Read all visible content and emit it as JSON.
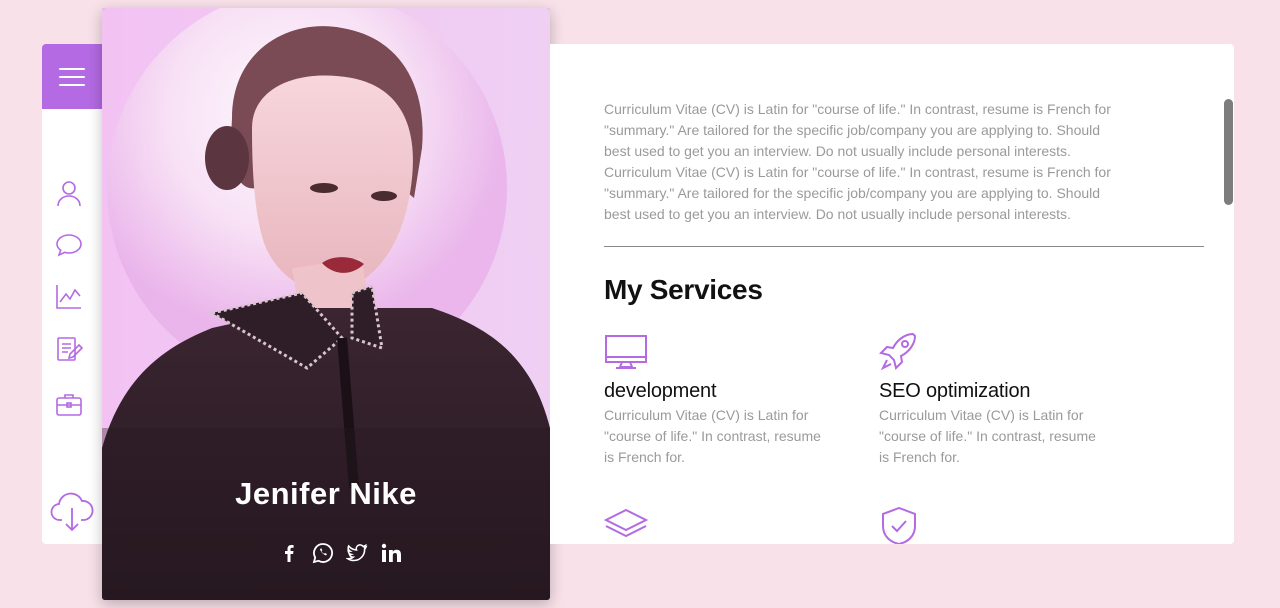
{
  "profile": {
    "name": "Jenifer Nike",
    "socials": [
      "facebook-icon",
      "whatsapp-icon",
      "twitter-icon",
      "linkedin-icon"
    ]
  },
  "sidebar": {
    "menu": "hamburger-menu-icon",
    "items": [
      "user-icon",
      "chat-icon",
      "chart-icon",
      "resume-icon",
      "briefcase-icon"
    ],
    "download": "cloud-download-icon"
  },
  "bio": {
    "paragraphs": [
      "Curriculum Vitae (CV) is Latin for \"course of life.\" In contrast, resume is French for \"summary.\" Are tailored for the specific job/company you are applying to. Should best used to get you an interview. Do not usually include personal interests.",
      "Curriculum Vitae (CV) is Latin for \"course of life.\" In contrast, resume is French for \"summary.\" Are tailored for the specific job/company you are applying to. Should best used to get you an interview. Do not usually include personal interests."
    ]
  },
  "services": {
    "title": "My Services",
    "items": [
      {
        "icon": "monitor-icon",
        "title": "development",
        "desc": "Curriculum Vitae (CV) is Latin for \"course of life.\" In contrast, resume is French for."
      },
      {
        "icon": "rocket-icon",
        "title": "SEO optimization",
        "desc": "Curriculum Vitae (CV) is Latin for \"course of life.\" In contrast, resume is French for."
      },
      {
        "icon": "layers-icon",
        "title": "",
        "desc": ""
      },
      {
        "icon": "shield-check-icon",
        "title": "",
        "desc": ""
      }
    ]
  },
  "colors": {
    "accent": "#b36ae2",
    "background": "#f8e1e8",
    "text_muted": "#9a9a9a"
  }
}
